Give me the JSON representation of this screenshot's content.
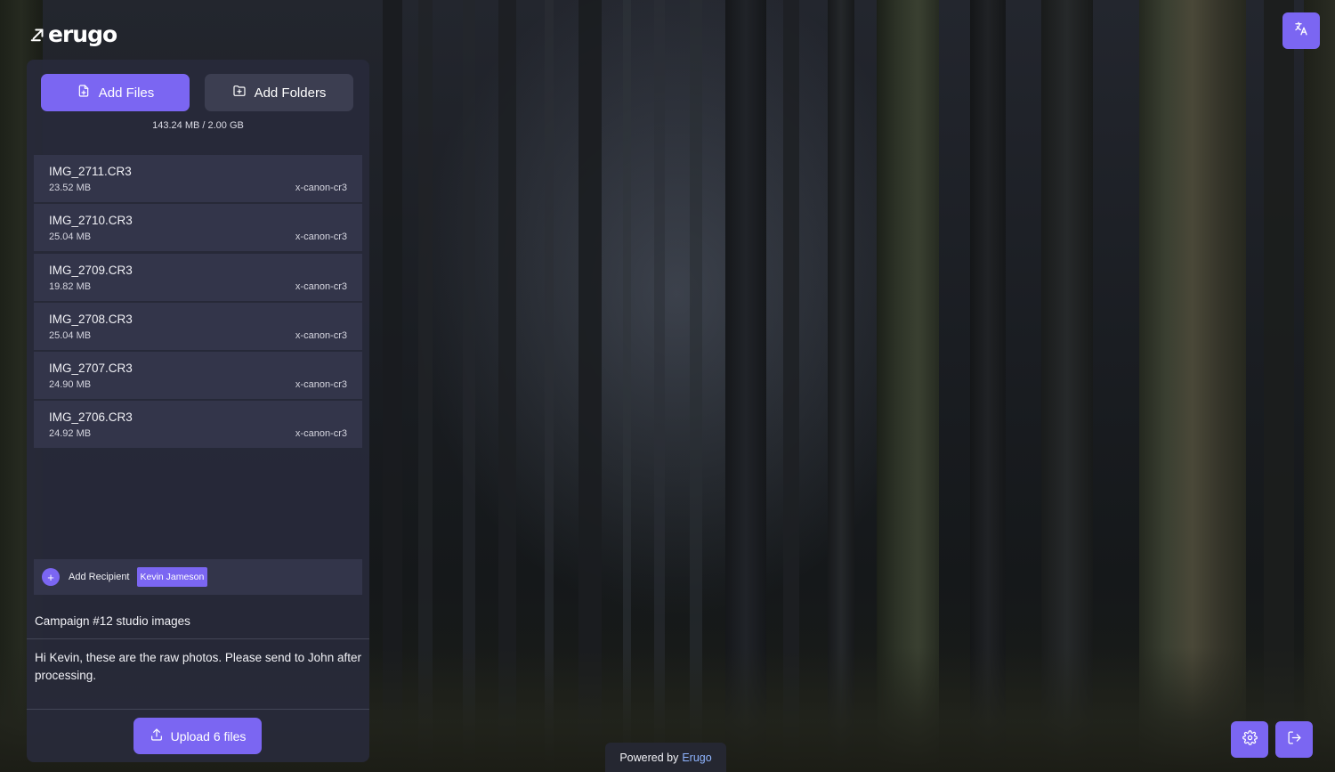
{
  "brand": {
    "logo_text": "erugo",
    "logo_icon": "arrow-up-right-icon"
  },
  "header": {
    "translate_icon": "translate-icon"
  },
  "actions": {
    "add_files_label": "Add Files",
    "add_folders_label": "Add Folders"
  },
  "quota": "143.24 MB / 2.00 GB",
  "files": [
    {
      "name": "IMG_2711.CR3",
      "size": "23.52 MB",
      "type": "x-canon-cr3"
    },
    {
      "name": "IMG_2710.CR3",
      "size": "25.04 MB",
      "type": "x-canon-cr3"
    },
    {
      "name": "IMG_2709.CR3",
      "size": "19.82 MB",
      "type": "x-canon-cr3"
    },
    {
      "name": "IMG_2708.CR3",
      "size": "25.04 MB",
      "type": "x-canon-cr3"
    },
    {
      "name": "IMG_2707.CR3",
      "size": "24.90 MB",
      "type": "x-canon-cr3"
    },
    {
      "name": "IMG_2706.CR3",
      "size": "24.92 MB",
      "type": "x-canon-cr3"
    }
  ],
  "recipients": {
    "add_label": "Add Recipient",
    "add_icon_text": "+",
    "chips": [
      "Kevin Jameson"
    ]
  },
  "share": {
    "subject": "Campaign #12 studio images",
    "message": "Hi Kevin, these are the raw photos. Please send to John after processing.",
    "upload_label": "Upload 6 files"
  },
  "footer": {
    "powered_prefix": "Powered by",
    "powered_brand": "Erugo"
  },
  "colors": {
    "accent": "#7b66f2",
    "panel": "#282a3a",
    "item": "#33354a",
    "link": "#8fb4ff"
  }
}
